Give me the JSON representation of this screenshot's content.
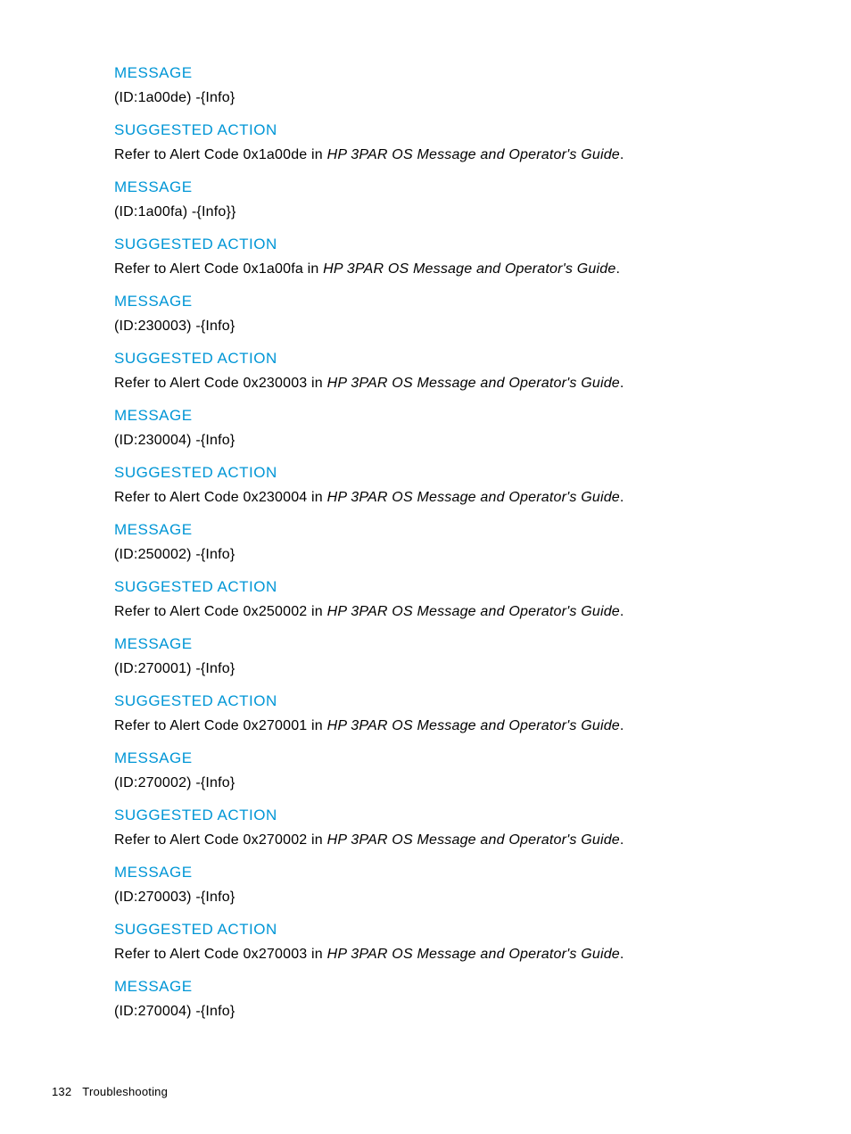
{
  "labels": {
    "message": "MESSAGE",
    "suggested_action": "SUGGESTED ACTION",
    "refer_prefix": "Refer to Alert Code ",
    "refer_in": " in ",
    "guide_title": "HP 3PAR OS Message and Operator's Guide",
    "period": "."
  },
  "entries": [
    {
      "id_text": "(ID:1a00de) -{Info}",
      "alert_code": "0x1a00de"
    },
    {
      "id_text": "(ID:1a00fa) -{Info}}",
      "alert_code": "0x1a00fa"
    },
    {
      "id_text": "(ID:230003) -{Info}",
      "alert_code": "0x230003"
    },
    {
      "id_text": "(ID:230004) -{Info}",
      "alert_code": "0x230004"
    },
    {
      "id_text": "(ID:250002) -{Info}",
      "alert_code": "0x250002"
    },
    {
      "id_text": "(ID:270001) -{Info}",
      "alert_code": "0x270001"
    },
    {
      "id_text": "(ID:270002) -{Info}",
      "alert_code": "0x270002"
    },
    {
      "id_text": "(ID:270003) -{Info}",
      "alert_code": "0x270003"
    }
  ],
  "trailing": {
    "id_text": "(ID:270004) -{Info}"
  },
  "footer": {
    "page_number": "132",
    "section_title": "Troubleshooting"
  }
}
